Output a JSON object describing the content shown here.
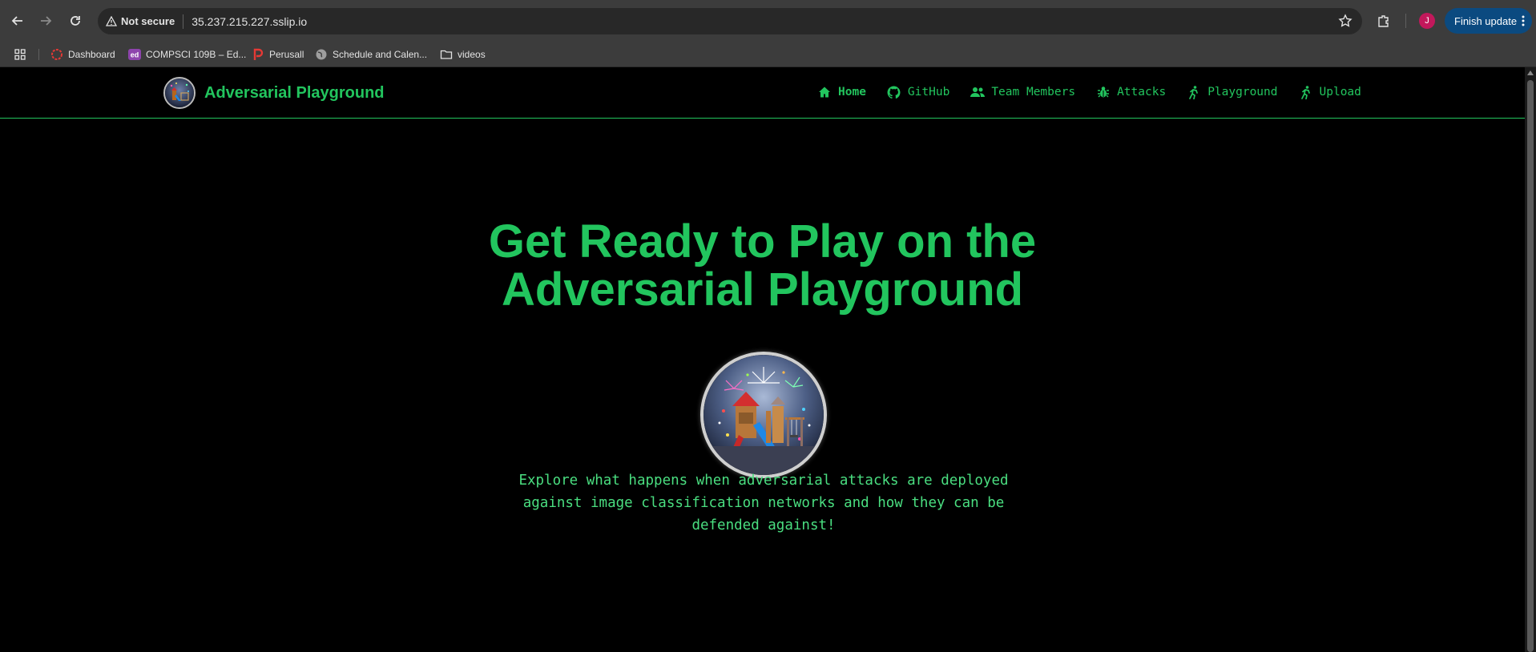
{
  "browser": {
    "security_label": "Not secure",
    "url": "35.237.215.227.sslip.io",
    "profile_initial": "J",
    "finish_update_label": "Finish update",
    "bookmarks": [
      {
        "label": "Dashboard",
        "icon": "dashboard-icon"
      },
      {
        "label": "COMPSCI 109B – Ed...",
        "icon": "ed-icon"
      },
      {
        "label": "Perusall",
        "icon": "perusall-icon"
      },
      {
        "label": "Schedule and Calen...",
        "icon": "globe-icon"
      },
      {
        "label": "videos",
        "icon": "folder-icon"
      }
    ]
  },
  "site": {
    "brand": "Adversarial Playground",
    "accent_color": "#22c55e",
    "nav": [
      {
        "label": "Home",
        "icon": "home-icon",
        "active": true
      },
      {
        "label": "GitHub",
        "icon": "github-icon"
      },
      {
        "label": "Team Members",
        "icon": "team-icon"
      },
      {
        "label": "Attacks",
        "icon": "bug-icon"
      },
      {
        "label": "Playground",
        "icon": "running-icon"
      },
      {
        "label": "Upload",
        "icon": "running-icon"
      }
    ]
  },
  "hero": {
    "title_line1": "Get Ready to Play on the",
    "title_line2": "Adversarial Playground",
    "description": "Explore what happens when adversarial attacks are deployed against image classification networks and how they can be defended against!"
  }
}
